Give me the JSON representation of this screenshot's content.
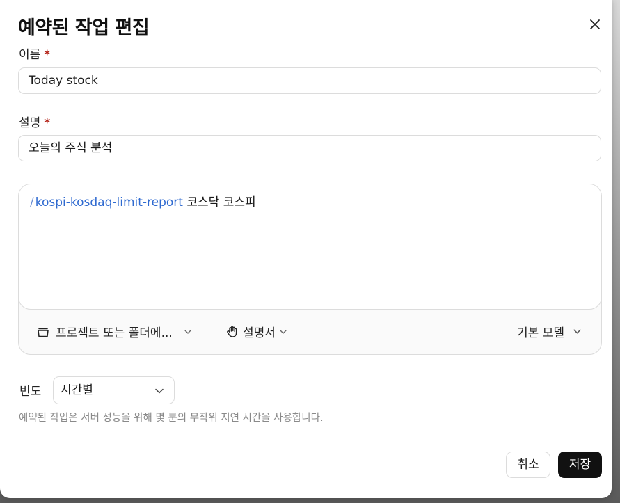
{
  "dialog": {
    "title": "예약된 작업 편집"
  },
  "name_field": {
    "label": "이름",
    "required_mark": "*",
    "value": "Today stock"
  },
  "description_field": {
    "label": "설명",
    "required_mark": "*",
    "value": "오늘의 주식 분석"
  },
  "prompt": {
    "slash": "/",
    "skill": "kospi-kosdaq-limit-report",
    "text": " 코스닥 코스피",
    "project_selector": "프로젝트 또는 폴더에...",
    "instructions": "설명서",
    "model_selector": "기본 모델"
  },
  "frequency": {
    "label": "빈도",
    "selected": "시간별",
    "hint": "예약된 작업은 서버 성능을 위해 몇 분의 무작위 지연 시간을 사용합니다."
  },
  "actions": {
    "cancel": "취소",
    "save": "저장"
  },
  "colors": {
    "skill_link": "#2f6ad0",
    "required": "#b42318",
    "primary_button": "#111111"
  },
  "icons": {
    "close": "close-icon",
    "folder": "folder-icon",
    "hand": "hand-icon",
    "chevron": "chevron-down-icon"
  }
}
